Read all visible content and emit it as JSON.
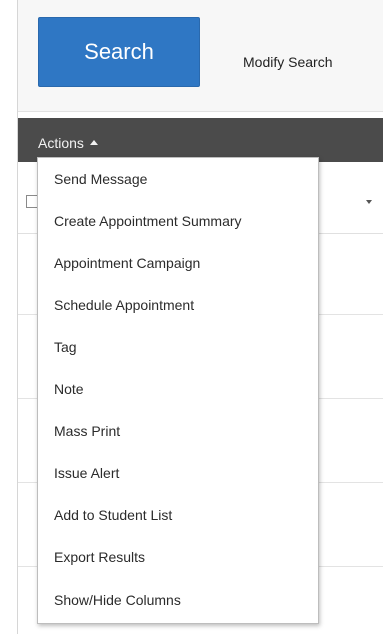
{
  "search": {
    "button_label": "Search",
    "modify_label": "Modify Search"
  },
  "actions": {
    "toggle_label": "Actions",
    "menu_items": [
      "Send Message",
      "Create Appointment Summary",
      "Appointment Campaign",
      "Schedule Appointment",
      "Tag",
      "Note",
      "Mass Print",
      "Issue Alert",
      "Add to Student List",
      "Export Results",
      "Show/Hide Columns"
    ]
  },
  "colors": {
    "search_button": "#2f77c4",
    "actions_bar": "#4b4b4b"
  },
  "icons": {
    "actions_caret": "caret-up-icon",
    "column_sort": "sort-caret-icon"
  }
}
